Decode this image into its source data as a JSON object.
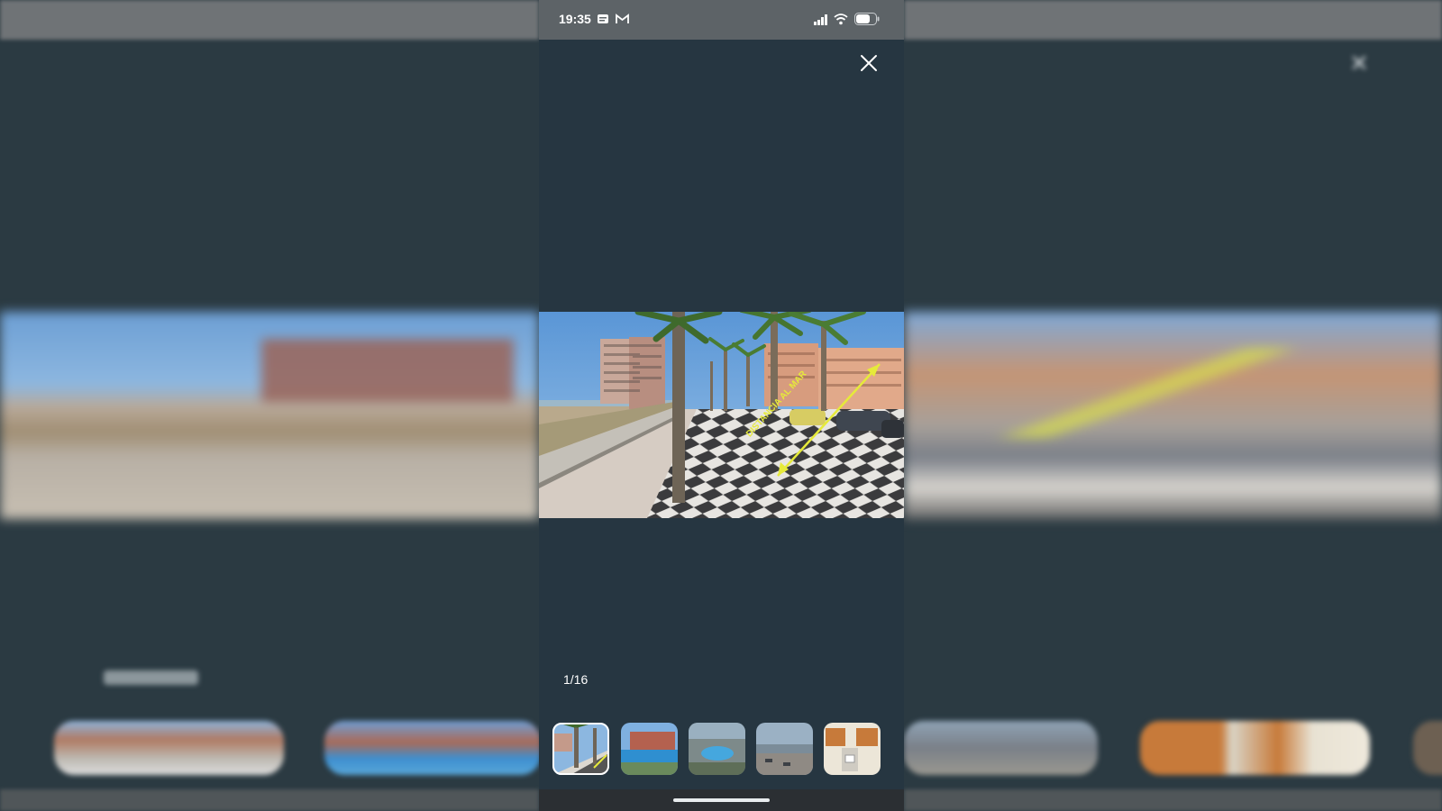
{
  "status_bar": {
    "time": "19:35",
    "notification_icons": [
      "message-icon",
      "gmail-icon"
    ],
    "system_icons": [
      "signal-icon",
      "wifi-icon",
      "battery-icon"
    ]
  },
  "viewer": {
    "counter": "1/16",
    "close_icon": "close-icon",
    "image_overlay_text": "DISTANCIA AL MAR",
    "thumbnails": [
      {
        "name": "thumbnail-1",
        "active": true
      },
      {
        "name": "thumbnail-2",
        "active": false
      },
      {
        "name": "thumbnail-3",
        "active": false
      },
      {
        "name": "thumbnail-4",
        "active": false
      },
      {
        "name": "thumbnail-5",
        "active": false
      }
    ]
  },
  "colors": {
    "background": "#2b3a42",
    "phone_background": "#263641",
    "status_bar": "#5d6367",
    "arrow_annotation": "#e6ea3a"
  }
}
